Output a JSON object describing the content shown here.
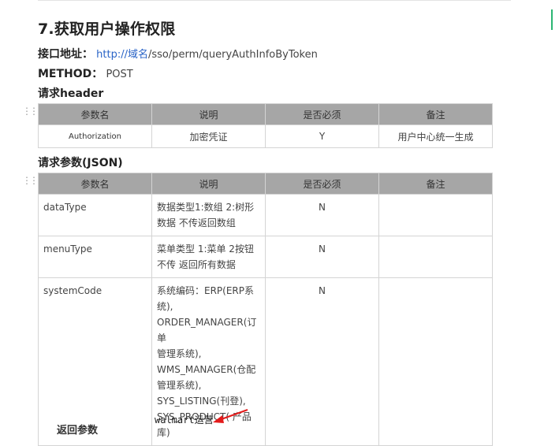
{
  "section": {
    "title": "7.获取用户操作权限",
    "endpoint_label": "接口地址：",
    "endpoint_link": "http://域名",
    "endpoint_path": "/sso/perm/queryAuthInfoByToken",
    "method_label": "METHOD：",
    "method_value": "POST",
    "header_title": "请求header",
    "params_title": "请求参数(JSON)"
  },
  "header_table": {
    "columns": [
      "参数名",
      "说明",
      "是否必须",
      "备注"
    ],
    "rows": [
      [
        "Authorization",
        "加密凭证",
        "Y",
        "用户中心统一生成"
      ]
    ]
  },
  "params_table": {
    "columns": [
      "参数名",
      "说明",
      "是否必须",
      "备注"
    ],
    "rows": [
      {
        "name": "dataType",
        "desc": [
          "数据类型1:数组 2:树形",
          "数据 不传返回数组"
        ],
        "required": "N",
        "note": ""
      },
      {
        "name": "menuType",
        "desc": [
          "菜单类型 1:菜单 2按钮",
          "不传 返回所有数据"
        ],
        "required": "N",
        "note": ""
      },
      {
        "name": "systemCode",
        "desc": [
          "系统编码：ERP(ERP系",
          "统),",
          "ORDER_MANAGER(订单",
          "管理系统),",
          "WMS_MANAGER(仓配",
          "管理系统),",
          "SYS_LISTING(刊登),",
          "SYS_PRODUCT( 产品库)"
        ],
        "required": "N",
        "note": ""
      }
    ]
  },
  "annotation": {
    "caption": "walmart运营",
    "arrow_color": "#e31b1b"
  },
  "next_section_partial": "返回参数"
}
